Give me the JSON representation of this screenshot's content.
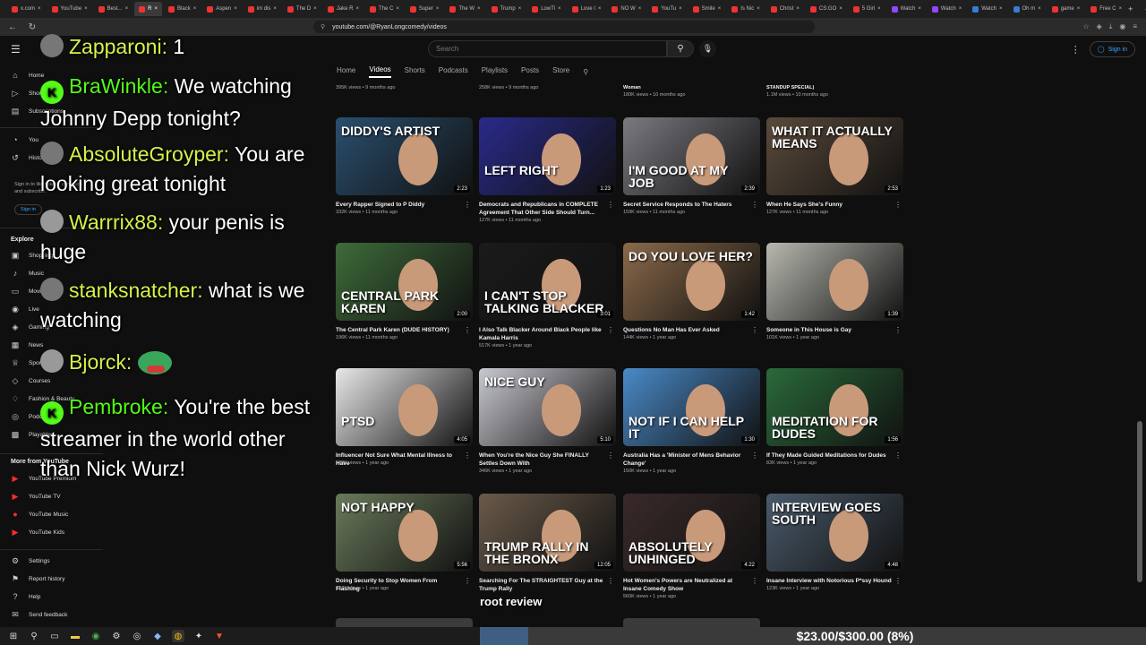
{
  "browser": {
    "tabs": [
      {
        "label": "x.com",
        "icon": "x-icon"
      },
      {
        "label": "YouTube",
        "icon": "youtube-icon"
      },
      {
        "label": "Best...",
        "icon": "youtube-icon"
      },
      {
        "label": "R",
        "icon": "youtube-icon",
        "active": true
      },
      {
        "label": "Black",
        "icon": "youtube-icon"
      },
      {
        "label": "Aspen",
        "icon": "youtube-icon"
      },
      {
        "label": "im dis",
        "icon": "youtube-icon"
      },
      {
        "label": "The D",
        "icon": "youtube-icon"
      },
      {
        "label": "Jake R",
        "icon": "youtube-icon"
      },
      {
        "label": "The C",
        "icon": "youtube-icon"
      },
      {
        "label": "Super",
        "icon": "youtube-icon"
      },
      {
        "label": "The W",
        "icon": "youtube-icon"
      },
      {
        "label": "Trump",
        "icon": "youtube-icon"
      },
      {
        "label": "LowTi",
        "icon": "youtube-icon"
      },
      {
        "label": "Love I",
        "icon": "youtube-icon"
      },
      {
        "label": "NO W",
        "icon": "youtube-icon"
      },
      {
        "label": "YouTu",
        "icon": "youtube-icon"
      },
      {
        "label": "Smile",
        "icon": "youtube-icon"
      },
      {
        "label": "Is Nic",
        "icon": "youtube-icon"
      },
      {
        "label": "Christ",
        "icon": "youtube-icon"
      },
      {
        "label": "CS:GO",
        "icon": "youtube-icon"
      },
      {
        "label": "5 Girl",
        "icon": "youtube-icon"
      },
      {
        "label": "Watch",
        "icon": "twitch-icon"
      },
      {
        "label": "Watch",
        "icon": "twitch-icon"
      },
      {
        "label": "Watch",
        "icon": "blue-icon"
      },
      {
        "label": "Oh m",
        "icon": "blue-icon"
      },
      {
        "label": "game",
        "icon": "youtube-icon"
      },
      {
        "label": "Free C",
        "icon": "youtube-icon"
      }
    ],
    "url": "youtube.com/@RyanLongcomedy/videos",
    "new_tab": "+",
    "min": "─",
    "max": "❐",
    "close": "✕"
  },
  "header": {
    "search_placeholder": "Search",
    "sign_in": "Sign in"
  },
  "sidebar": {
    "top_items": [
      {
        "label": "Home",
        "icon": "home-icon"
      },
      {
        "label": "Shorts",
        "icon": "shorts-icon"
      },
      {
        "label": "Subscriptions",
        "icon": "subscriptions-icon"
      }
    ],
    "you_items": [
      {
        "label": "You",
        "icon": "you-icon"
      },
      {
        "label": "History",
        "icon": "history-icon"
      }
    ],
    "sign_in_prompt": "Sign in to like videos, comment, and subscribe.",
    "sign_in_button": "Sign in",
    "explore_heading": "Explore",
    "explore_items": [
      {
        "label": "Shopping",
        "icon": "shopping-icon"
      },
      {
        "label": "Music",
        "icon": "music-icon"
      },
      {
        "label": "Movies & TV",
        "icon": "movies-icon"
      },
      {
        "label": "Live",
        "icon": "live-icon"
      },
      {
        "label": "Gaming",
        "icon": "gaming-icon"
      },
      {
        "label": "News",
        "icon": "news-icon"
      },
      {
        "label": "Sports",
        "icon": "sports-icon"
      },
      {
        "label": "Courses",
        "icon": "courses-icon"
      },
      {
        "label": "Fashion & Beauty",
        "icon": "fashion-icon"
      },
      {
        "label": "Podcasts",
        "icon": "podcasts-icon"
      },
      {
        "label": "Playables",
        "icon": "playables-icon"
      }
    ],
    "more_heading": "More from YouTube",
    "more_items": [
      {
        "label": "YouTube Premium",
        "icon": "yt-premium-icon"
      },
      {
        "label": "YouTube TV",
        "icon": "yt-tv-icon"
      },
      {
        "label": "YouTube Music",
        "icon": "yt-music-icon"
      },
      {
        "label": "YouTube Kids",
        "icon": "yt-kids-icon"
      }
    ],
    "bottom_items": [
      {
        "label": "Settings",
        "icon": "settings-icon"
      },
      {
        "label": "Report history",
        "icon": "flag-icon"
      },
      {
        "label": "Help",
        "icon": "help-icon"
      },
      {
        "label": "Send feedback",
        "icon": "feedback-icon"
      }
    ]
  },
  "chat": [
    {
      "user": "Zapparoni",
      "text": "1",
      "badge": "avatar"
    },
    {
      "user": "BraWinkle",
      "text": "We watching Johnny Depp tonight?",
      "badge": "kick"
    },
    {
      "user": "AbsoluteGroyper",
      "text": "You are looking great tonight",
      "badge": "avatar"
    },
    {
      "user": "Warrrix88",
      "text": "your penis is huge",
      "badge": "avatar"
    },
    {
      "user": "stanksnatcher",
      "text": "what is we watching",
      "badge": "avatar"
    },
    {
      "user": "Bjorck",
      "text": "",
      "badge": "avatar",
      "emote": "pepe-emote"
    },
    {
      "user": "Pembroke",
      "text": "You're the best streamer in the world other than Nick Wurz!",
      "badge": "kick"
    }
  ],
  "channel_tabs": [
    {
      "label": "Home"
    },
    {
      "label": "Videos",
      "active": true
    },
    {
      "label": "Shorts"
    },
    {
      "label": "Podcasts"
    },
    {
      "label": "Playlists"
    },
    {
      "label": "Posts"
    },
    {
      "label": "Store"
    }
  ],
  "partial_row": [
    {
      "title": "",
      "meta": "395K views • 9 months ago"
    },
    {
      "title": "",
      "meta": "258K views • 9 months ago"
    },
    {
      "title": "Woman",
      "meta": "180K views • 10 months ago"
    },
    {
      "title": "STANDUP SPECIAL)",
      "meta": "1.1M views • 10 months ago"
    }
  ],
  "videos": [
    {
      "title": "Every Rapper Signed to P Diddy",
      "meta": "332K views • 11 months ago",
      "duration": "2:23",
      "thumb_text": "DIDDY's ARTIST",
      "bg": "#2a4f6e"
    },
    {
      "title": "Democrats and Republicans in COMPLETE Agreement That Other Side Should Turn...",
      "meta": "127K views • 11 months ago",
      "duration": "1:23",
      "thumb_text": "LEFT RIGHT",
      "bg": "#2a2a8a"
    },
    {
      "title": "Secret Service Responds to The Haters",
      "meta": "159K views • 11 months ago",
      "duration": "2:39",
      "thumb_text": "I'M GOOD AT MY JOB",
      "bg": "#7a7a80"
    },
    {
      "title": "When He Says She's Funny",
      "meta": "127K views • 11 months ago",
      "duration": "2:53",
      "thumb_text": "WHAT IT ACTUALLY MEANS",
      "bg": "#5a4a3a"
    },
    {
      "title": "The Central Park Karen (DUDE HISTORY)",
      "meta": "196K views • 11 months ago",
      "duration": "2:00",
      "thumb_text": "CENTRAL PARK KAREN",
      "bg": "#3e6b3a"
    },
    {
      "title": "I Also Talk Blacker Around Black People like Kamala Harris",
      "meta": "517K views • 1 year ago",
      "duration": "3:01",
      "thumb_text": "I CAN'T STOP TALKING BLACKER",
      "bg": "#1a1a1a"
    },
    {
      "title": "Questions No Man Has Ever Asked",
      "meta": "144K views • 1 year ago",
      "duration": "1:42",
      "thumb_text": "DO YOU LOVE HER?",
      "bg": "#8a6a4a"
    },
    {
      "title": "Someone in This House is Gay",
      "meta": "101K views • 1 year ago",
      "duration": "1:39",
      "thumb_text": "",
      "bg": "#b8b8b0"
    },
    {
      "title": "Influencer Not Sure What Mental Illness to Have",
      "meta": "128K views • 1 year ago",
      "duration": "4:05",
      "thumb_text": "PTSD",
      "bg": "#e8e8e8"
    },
    {
      "title": "When You're the Nice Guy She FINALLY Settles Down With",
      "meta": "346K views • 1 year ago",
      "duration": "5:10",
      "thumb_text": "NICE GUY",
      "bg": "#c8c8d0"
    },
    {
      "title": "Australia Has a 'Minister of Mens Behavior Change'",
      "meta": "150K views • 1 year ago",
      "duration": "1:30",
      "thumb_text": "NOT IF I CAN HELP IT",
      "bg": "#4a8ac8"
    },
    {
      "title": "If They Made Guided Meditations for Dudes",
      "meta": "83K views • 1 year ago",
      "duration": "1:56",
      "thumb_text": "MEDITATION FOR DUDES",
      "bg": "#2a6a3a"
    },
    {
      "title": "Doing Security to Stop Women From Flashing",
      "meta": "127K views • 1 year ago",
      "duration": "5:56",
      "thumb_text": "NOT HAPPY",
      "bg": "#6a7a5a"
    },
    {
      "title": "Searching For The STRAIGHTEST Guy at the Trump Rally",
      "meta": "",
      "duration": "12:05",
      "thumb_text": "TRUMP RALLY IN THE BRONX",
      "bg": "#6a5a4a"
    },
    {
      "title": "Hot Women's Powers are Neutralized at Insane Comedy Show",
      "meta": "560K views • 1 year ago",
      "duration": "4:22",
      "thumb_text": "ABSOLUTELY UNHINGED",
      "bg": "#3a2a2a"
    },
    {
      "title": "Insane Interview with Notorious P*ssy Hound",
      "meta": "123K views • 1 year ago",
      "duration": "4:48",
      "thumb_text": "INTERVIEW GOES SOUTH",
      "bg": "#4a5a6a"
    }
  ],
  "stream_caption": "root review",
  "donation_goal": "$23.00/$300.00 (8%)"
}
